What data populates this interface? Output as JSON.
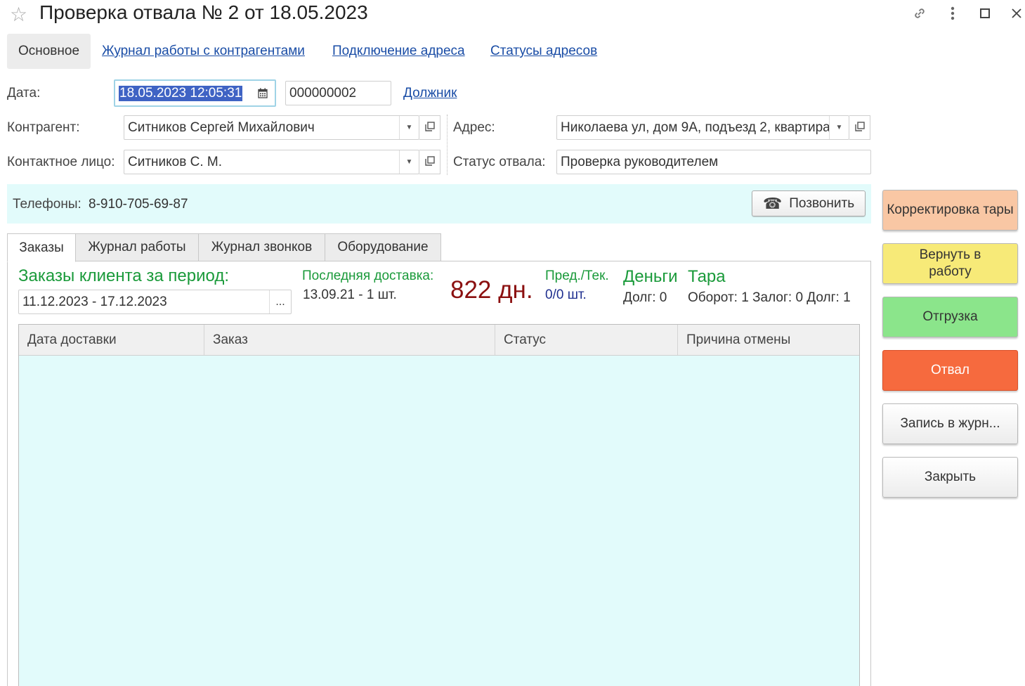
{
  "window": {
    "title": "Проверка отвала № 2 от 18.05.2023",
    "icons": [
      "star-icon",
      "link-icon",
      "more-icon",
      "maximize-icon",
      "close-icon"
    ]
  },
  "nav": {
    "main": "Основное",
    "links": [
      "Журнал работы с контрагентами",
      "Подключение адреса",
      "Статусы адресов"
    ]
  },
  "form": {
    "date_label": "Дата:",
    "date_value": "18.05.2023 12:05:31",
    "number_value": "000000002",
    "debtor_link": "Должник",
    "counterparty_label": "Контрагент:",
    "counterparty_value": "Ситников Сергей Михайлович",
    "address_label": "Адрес:",
    "address_value": "Николаева ул,  дом 9А,  подъезд 2,  квартира",
    "contact_label": "Контактное лицо:",
    "contact_value": "Ситников С. М.",
    "status_label": "Статус отвала:",
    "status_value": "Проверка руководителем"
  },
  "phones": {
    "label": "Телефоны:",
    "value": "8-910-705-69-87",
    "call_button": "Позвонить"
  },
  "tabs": [
    "Заказы",
    "Журнал работы",
    "Журнал звонков",
    "Оборудование"
  ],
  "orders": {
    "period_title": "Заказы клиента за период:",
    "period_value": "11.12.2023 - 17.12.2023",
    "period_button": "...",
    "last_delivery_label": "Последняя доставка:",
    "last_delivery_value": "13.09.21 - 1 шт.",
    "days": "822 дн.",
    "prev_cur_label": "Пред./Тек.",
    "prev_cur_value": "0/0 шт.",
    "money_label": "Деньги",
    "money_value": "Долг: 0",
    "tare_label": "Тара",
    "tare_value": "Оборот: 1 Залог: 0 Долг: 1",
    "columns": [
      "Дата доставки",
      "Заказ",
      "Статус",
      "Причина отмены"
    ]
  },
  "side_buttons": [
    {
      "label": "Корректировка тары",
      "color": "#f9c7a4"
    },
    {
      "label": "Вернуть в работу",
      "color": "#f7ea78"
    },
    {
      "label": "Отгрузка",
      "color": "#8be58b"
    },
    {
      "label": "Отвал",
      "color": "#f66a3e"
    },
    {
      "label": "Запись в журн...",
      "color": "#f2f2f2"
    },
    {
      "label": "Закрыть",
      "color": "#f2f2f2"
    }
  ],
  "colors": {
    "accent_green": "#1a9a3a",
    "days_red": "#8b1010",
    "link_blue": "#1a4da6",
    "highlight_bg": "#e2fbfb"
  }
}
